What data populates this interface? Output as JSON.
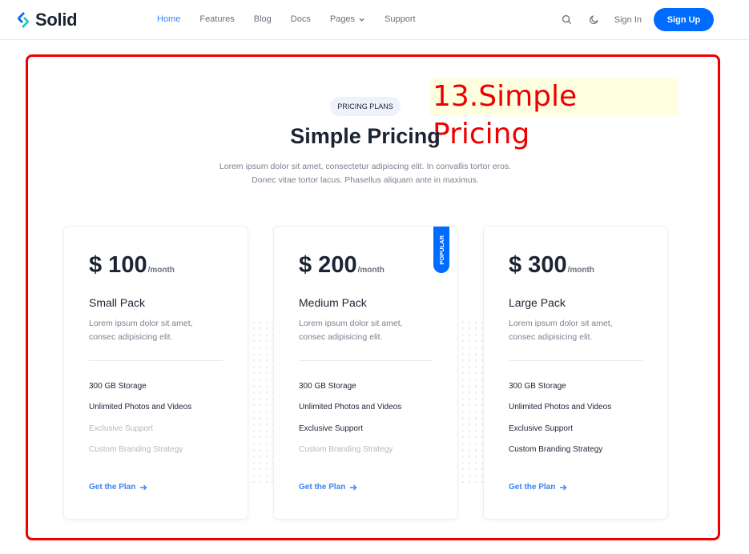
{
  "brand": {
    "name": "Solid",
    "accent": "#006bff",
    "link": "#3c82f6"
  },
  "nav": {
    "items": [
      {
        "label": "Home"
      },
      {
        "label": "Features"
      },
      {
        "label": "Blog"
      },
      {
        "label": "Docs"
      },
      {
        "label": "Pages"
      },
      {
        "label": "Support"
      }
    ],
    "active": "Home"
  },
  "header_actions": {
    "search_icon": "search-icon",
    "theme_icon": "moon-icon",
    "signin": "Sign In",
    "signup": "Sign Up"
  },
  "annotation": {
    "text": "13.Simple Pricing",
    "color": "#ee0000"
  },
  "section": {
    "badge": "PRICING PLANS",
    "title": "Simple Pricing",
    "subtitle_line1": "Lorem ipsum dolor sit amet, consectetur adipiscing elit. In convallis tortor eros.",
    "subtitle_line2": "Donec vitae tortor lacus. Phasellus aliquam ante in maximus."
  },
  "plans": [
    {
      "price": "$ 100",
      "per": "/month",
      "name": "Small Pack",
      "desc": "Lorem ipsum dolor sit amet, consec adipisicing elit.",
      "features": [
        "300 GB Storage",
        "Unlimited Photos and Videos",
        "Exclusive Support",
        "Custom Branding Strategy"
      ],
      "included": [
        true,
        true,
        false,
        false
      ],
      "cta": "Get the Plan",
      "popular": ""
    },
    {
      "price": "$ 200",
      "per": "/month",
      "name": "Medium Pack",
      "desc": "Lorem ipsum dolor sit amet, consec adipisicing elit.",
      "features": [
        "300 GB Storage",
        "Unlimited Photos and Videos",
        "Exclusive Support",
        "Custom Branding Strategy"
      ],
      "included": [
        true,
        true,
        true,
        false
      ],
      "cta": "Get the Plan",
      "popular": "POPULAR"
    },
    {
      "price": "$ 300",
      "per": "/month",
      "name": "Large Pack",
      "desc": "Lorem ipsum dolor sit amet, consec adipisicing elit.",
      "features": [
        "300 GB Storage",
        "Unlimited Photos and Videos",
        "Exclusive Support",
        "Custom Branding Strategy"
      ],
      "included": [
        true,
        true,
        true,
        true
      ],
      "cta": "Get the Plan",
      "popular": ""
    }
  ]
}
